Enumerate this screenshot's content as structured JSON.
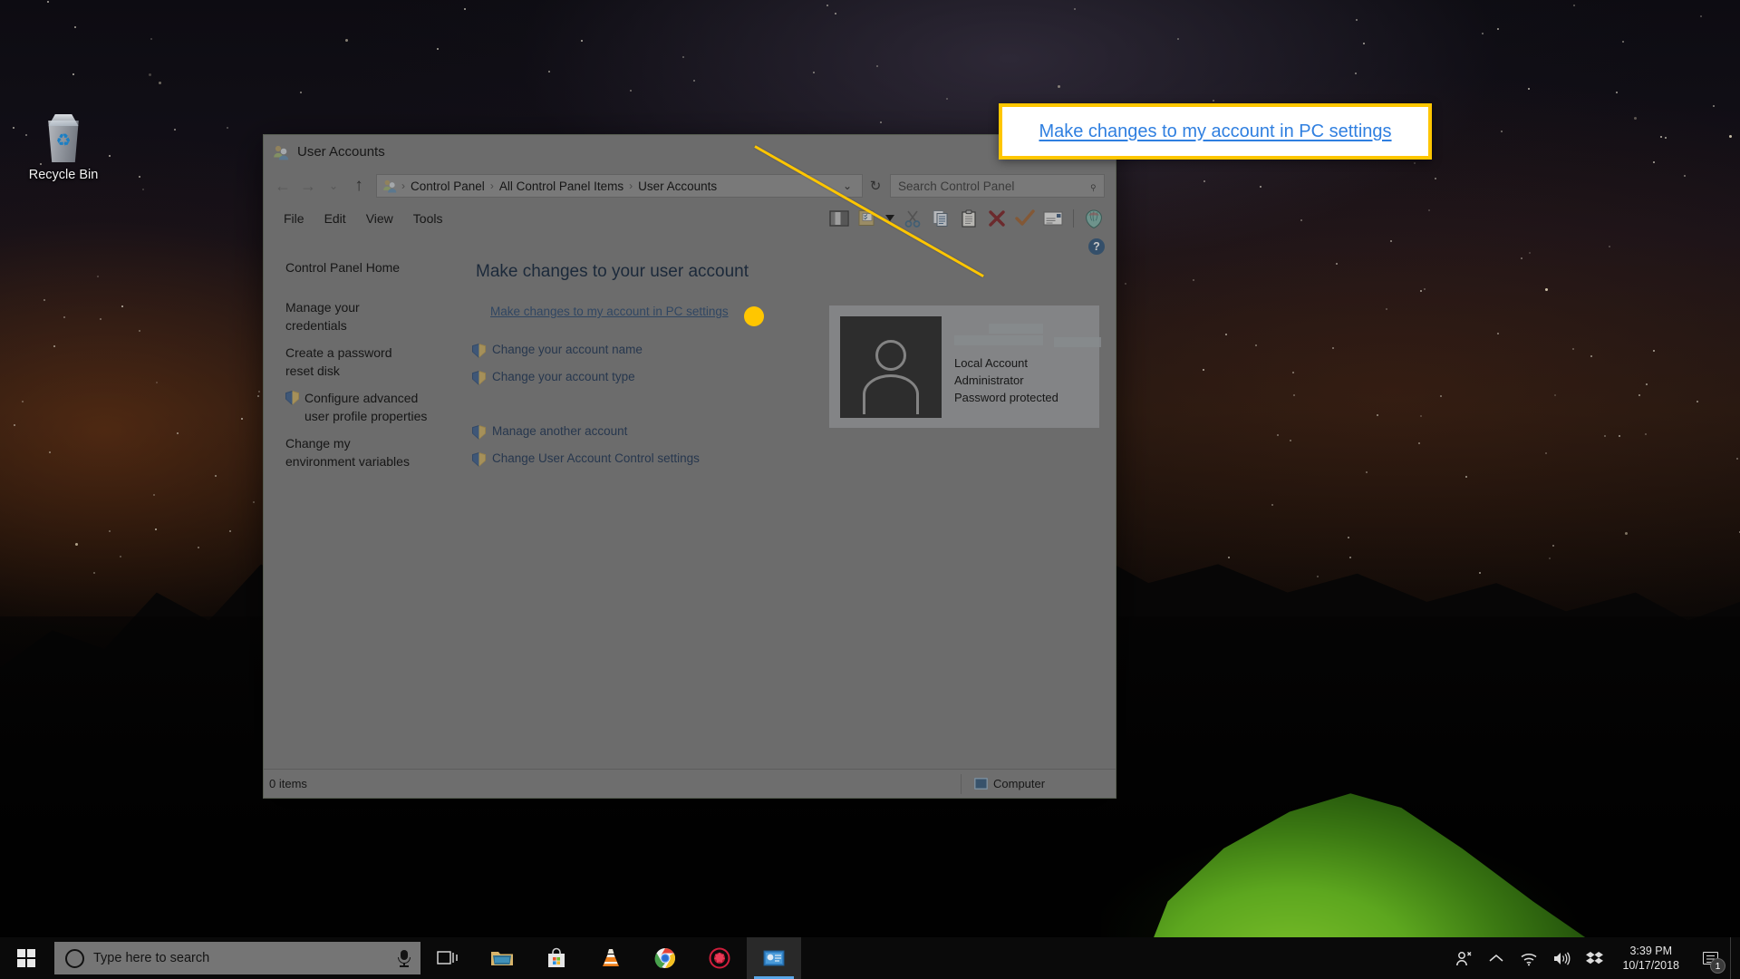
{
  "desktop": {
    "recycle_bin": {
      "label": "Recycle Bin",
      "icon": "recycle-bin-icon"
    }
  },
  "window": {
    "title": "User Accounts",
    "title_icon": "user-accounts-icon",
    "controls": {
      "minimize": "–",
      "maximize": "▢",
      "close": "✕"
    },
    "address_bar": {
      "back_icon": "←",
      "forward_icon": "→",
      "recent_icon": "⌄",
      "up_icon": "↑",
      "path_icon": "user-accounts-icon",
      "crumbs": [
        "Control Panel",
        "All Control Panel Items",
        "User Accounts"
      ],
      "separator": "›",
      "dropdown_icon": "⌄",
      "refresh_icon": "↻"
    },
    "search": {
      "placeholder": "Search Control Panel",
      "icon": "search-icon"
    },
    "menu": [
      "File",
      "Edit",
      "View",
      "Tools"
    ],
    "toolbar_icons": [
      "preview-pane-icon",
      "layout-options-icon",
      "layout-dropdown-icon",
      "cut-icon",
      "copy-icon",
      "paste-icon",
      "delete-icon",
      "confirm-icon",
      "rename-icon",
      "properties-icon"
    ],
    "help_icon": "?",
    "nav_pane": [
      {
        "label": "Control Panel Home",
        "shield": false
      },
      {
        "label": "Manage your credentials",
        "shield": false
      },
      {
        "label": "Create a password reset disk",
        "shield": false
      },
      {
        "label": "Configure advanced user profile properties",
        "shield": true
      },
      {
        "label": "Change my environment variables",
        "shield": false
      }
    ],
    "main": {
      "heading": "Make changes to your user account",
      "pc_settings_link": "Make changes to my account in PC settings",
      "group_one": [
        "Change your account name",
        "Change your account type"
      ],
      "group_two": [
        "Manage another account",
        "Change User Account Control settings"
      ]
    },
    "account_card": {
      "avatar_icon": "generic-user-avatar",
      "name_redacted": true,
      "lines": [
        "Local Account",
        "Administrator",
        "Password protected"
      ]
    },
    "status_bar": {
      "items": "0 items",
      "location": "Computer",
      "location_icon": "computer-icon"
    }
  },
  "callout": {
    "text": "Make changes to my account in PC settings",
    "border_color": "#ffc600",
    "background": "#ffffff",
    "link_color": "#2f7fe0"
  },
  "taskbar": {
    "start_icon": "windows-logo-icon",
    "search": {
      "placeholder": "Type here to search",
      "circle_icon": "cortana-circle-icon",
      "mic_icon": "microphone-icon"
    },
    "apps": [
      {
        "name": "task-view-icon",
        "label": "Task View",
        "active": false
      },
      {
        "name": "file-explorer-icon",
        "label": "File Explorer",
        "active": false
      },
      {
        "name": "microsoft-store-icon",
        "label": "Microsoft Store",
        "active": false
      },
      {
        "name": "vlc-icon",
        "label": "VLC media player",
        "active": false
      },
      {
        "name": "chrome-icon",
        "label": "Google Chrome",
        "active": false
      },
      {
        "name": "ccleaner-icon",
        "label": "CCleaner",
        "active": false
      },
      {
        "name": "control-panel-icon",
        "label": "User Accounts",
        "active": true
      }
    ],
    "tray": [
      {
        "name": "people-icon",
        "glyph": "person"
      },
      {
        "name": "show-hidden-icons-icon",
        "glyph": "chevron-up"
      },
      {
        "name": "network-icon",
        "glyph": "wifi"
      },
      {
        "name": "volume-icon",
        "glyph": "speaker"
      },
      {
        "name": "dropbox-icon",
        "glyph": "dropbox"
      }
    ],
    "clock": {
      "time": "3:39 PM",
      "date": "10/17/2018"
    },
    "notifications": {
      "icon": "action-center-icon",
      "count": "1"
    }
  }
}
